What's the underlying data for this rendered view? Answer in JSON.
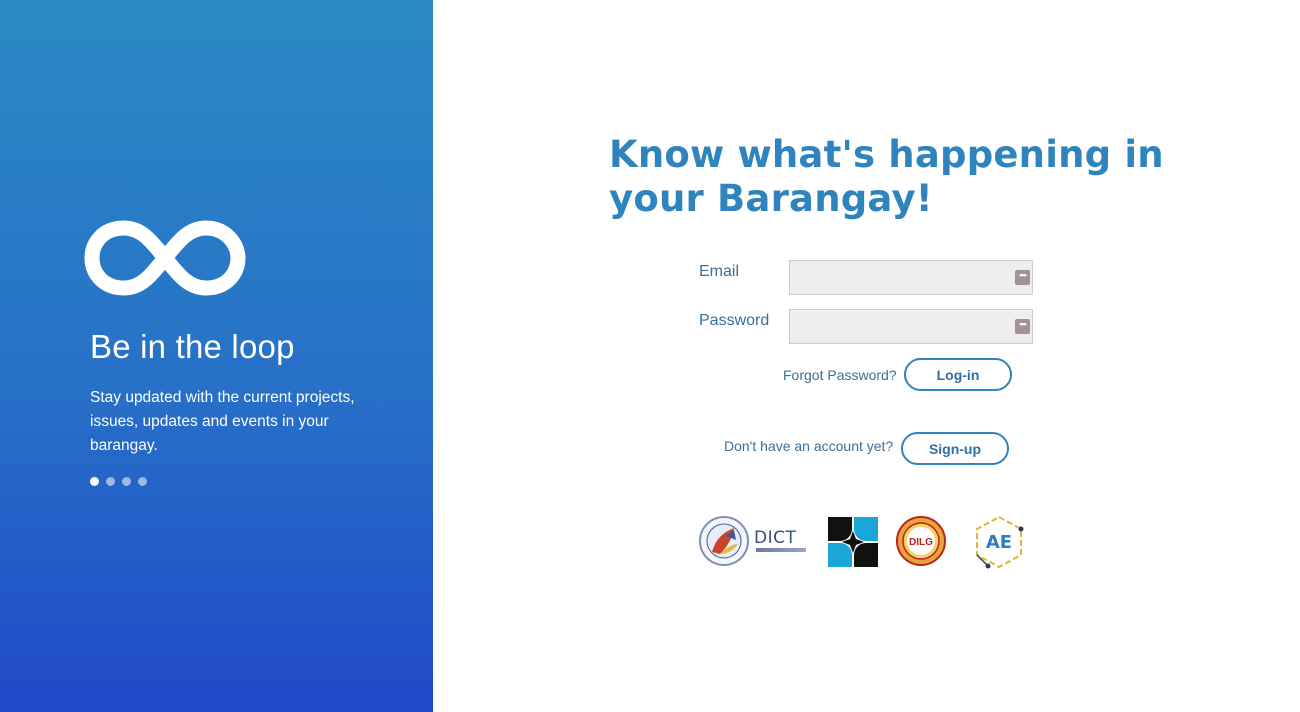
{
  "left_panel": {
    "title": "Be in the loop",
    "description": "Stay updated with the current projects, issues, updates and events in your barangay.",
    "carousel": {
      "total": 4,
      "active_index": 0
    },
    "logo_icon": "infinity-icon"
  },
  "main": {
    "headline": "Know what's happening in your Barangay!",
    "form": {
      "email_label": "Email",
      "email_value": "",
      "password_label": "Password",
      "password_value": "",
      "forgot_password": "Forgot Password?",
      "login_button": "Log-in",
      "no_account": "Don't have an account yet?",
      "signup_button": "Sign-up"
    },
    "partner_logos": {
      "dict_text": "DICT",
      "dilg_text": "DILG",
      "ae_text": "AE"
    }
  },
  "colors": {
    "accent": "#2f84bd",
    "panel_top": "#2a8ac2",
    "panel_bottom": "#2048c8",
    "label": "#3a6f9c"
  }
}
